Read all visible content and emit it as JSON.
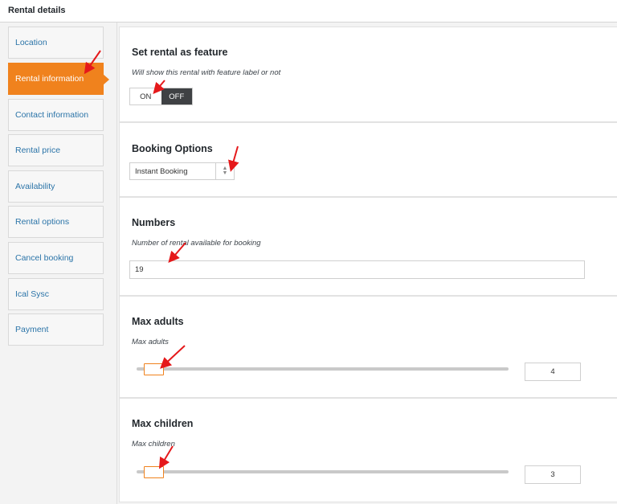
{
  "header": {
    "title": "Rental details"
  },
  "sidebar": {
    "items": [
      {
        "label": "Location",
        "active": false
      },
      {
        "label": "Rental information",
        "active": true
      },
      {
        "label": "Contact information",
        "active": false
      },
      {
        "label": "Rental price",
        "active": false
      },
      {
        "label": "Availability",
        "active": false
      },
      {
        "label": "Rental options",
        "active": false
      },
      {
        "label": "Cancel booking",
        "active": false
      },
      {
        "label": "Ical Sysc",
        "active": false
      },
      {
        "label": "Payment",
        "active": false
      }
    ]
  },
  "feature": {
    "title": "Set rental as feature",
    "desc": "Will show this rental with feature label or not",
    "on_label": "ON",
    "off_label": "OFF",
    "selected": "OFF"
  },
  "booking": {
    "title": "Booking Options",
    "selected": "Instant Booking"
  },
  "numbers": {
    "title": "Numbers",
    "desc": "Number of rental available for booking",
    "value": "19"
  },
  "max_adults": {
    "title": "Max adults",
    "desc": "Max adults",
    "value": "4"
  },
  "max_children": {
    "title": "Max children",
    "desc": "Max children",
    "value": "3"
  },
  "colors": {
    "accent": "#f0821d",
    "link": "#2b74a8",
    "annotation": "#e5191b"
  },
  "annotations": {
    "icon": "red-arrow-icon"
  }
}
